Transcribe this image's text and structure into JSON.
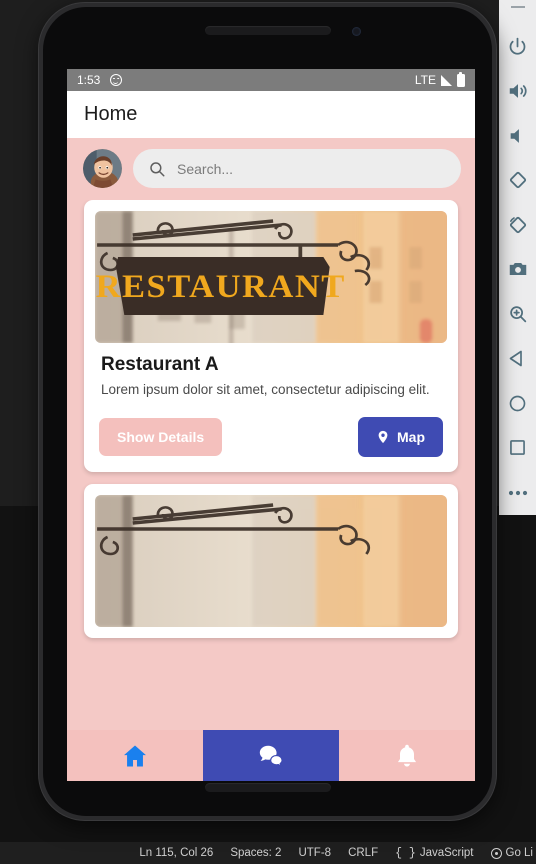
{
  "emulator_toolbar": {
    "name": "android-emulator-toolbar",
    "minimize_label": "—",
    "buttons": [
      {
        "name": "power-icon",
        "label": "Power"
      },
      {
        "name": "volume-up-icon",
        "label": "Volume Up"
      },
      {
        "name": "volume-down-icon",
        "label": "Volume Down"
      },
      {
        "name": "rotate-left-icon",
        "label": "Rotate Left"
      },
      {
        "name": "rotate-right-icon",
        "label": "Rotate Right"
      },
      {
        "name": "camera-icon",
        "label": "Take Screenshot"
      },
      {
        "name": "zoom-icon",
        "label": "Enter Zoom Mode"
      },
      {
        "name": "back-icon",
        "label": "Back"
      },
      {
        "name": "home-icon",
        "label": "Home"
      },
      {
        "name": "overview-icon",
        "label": "Overview"
      },
      {
        "name": "more-icon",
        "label": "More"
      }
    ]
  },
  "vscode_status_bar": {
    "cursor_position": "Ln 115, Col 26",
    "indentation": "Spaces: 2",
    "encoding": "UTF-8",
    "eol": "CRLF",
    "language": "JavaScript",
    "language_icon": "braces-icon",
    "live_server": "Go Li",
    "live_server_icon": "broadcast-icon"
  },
  "phone": {
    "status_bar": {
      "time": "1:53",
      "notification_icon": "smiley-icon",
      "network": "LTE",
      "signal_icon": "signal-triangle-icon",
      "battery_icon": "battery-full-icon"
    },
    "app_bar": {
      "title": "Home"
    },
    "search": {
      "avatar_name": "user-avatar",
      "search_icon": "search-icon",
      "placeholder": "Search..."
    },
    "cards": [
      {
        "image_alt": "restaurant-sign-photo",
        "image_sign_text": "RESTAURANT",
        "title": "Restaurant A",
        "description": "Lorem ipsum dolor sit amet, consectetur adipiscing elit.",
        "details_button": "Show Details",
        "map_button": "Map",
        "map_icon": "map-pin-icon"
      },
      {
        "image_alt": "restaurant-sign-photo",
        "image_sign_text": "",
        "title": "",
        "description": "",
        "details_button": "",
        "map_button": "",
        "map_icon": "map-pin-icon"
      }
    ],
    "bottom_nav": {
      "items": [
        {
          "name": "nav-home",
          "icon": "home-icon",
          "active": false
        },
        {
          "name": "nav-chat",
          "icon": "chat-bubbles-icon",
          "active": true
        },
        {
          "name": "nav-notifications",
          "icon": "bell-icon",
          "active": false
        }
      ]
    }
  },
  "colors": {
    "accent_pink": "#f4c9c6",
    "accent_indigo": "#3f4bb3",
    "nav_home_blue": "#1a80ee",
    "status_bar_gray": "#7c7c7c",
    "button_pink": "#f4c0bd"
  }
}
